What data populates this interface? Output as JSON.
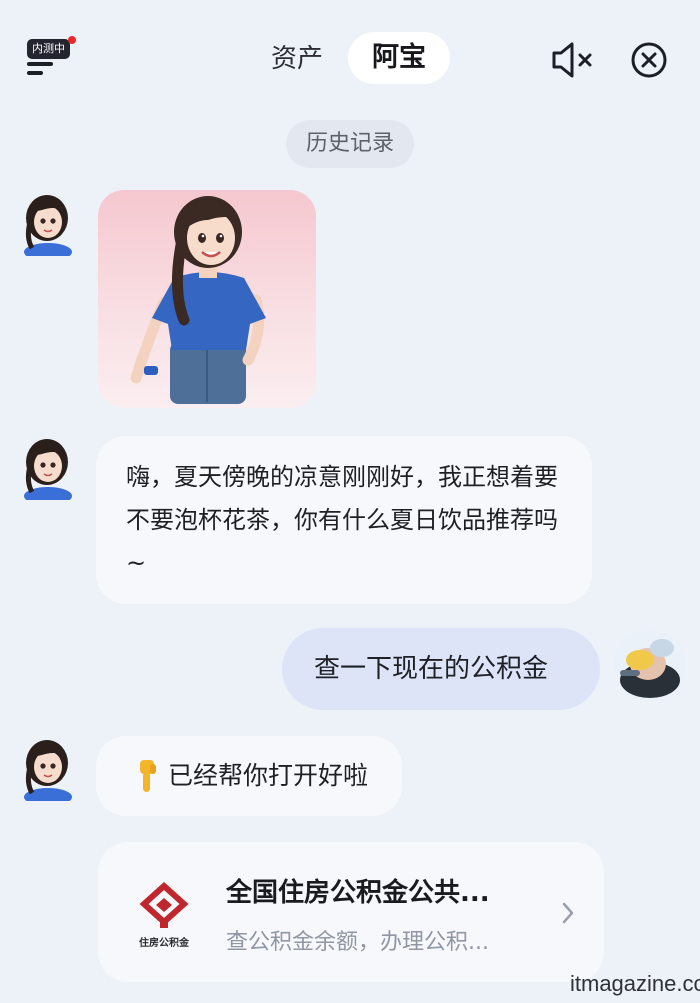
{
  "header": {
    "beta_badge": "内测中",
    "tabs": [
      {
        "label": "资产",
        "active": false
      },
      {
        "label": "阿宝",
        "active": true
      }
    ],
    "icons": {
      "menu": "menu-icon",
      "mute": "speaker-mute-icon",
      "close": "close-circle-icon"
    }
  },
  "history_label": "历史记录",
  "messages": [
    {
      "sender": "ai",
      "type": "image",
      "alt": "ai-character-portrait"
    },
    {
      "sender": "ai",
      "type": "text",
      "text": "嗨，夏天傍晚的凉意刚刚好，我正想着要不要泡杯花茶，你有什么夏日饮品推荐吗~"
    },
    {
      "sender": "user",
      "type": "text",
      "text": "查一下现在的公积金"
    },
    {
      "sender": "ai",
      "type": "text",
      "emoji": "👇",
      "text": "已经帮你打开好啦"
    }
  ],
  "service_card": {
    "logo_text": "住房公积金",
    "title": "全国住房公积金公共...",
    "desc": "查公积金余额，办理公积...",
    "brand_color": "#c0272d"
  },
  "colors": {
    "background": "#edf2f9",
    "bubble_ai": "#f6f8fc",
    "bubble_user": "#dde4f7",
    "accent_dot": "#ec2a2a"
  },
  "watermark": "itmagazine.cc"
}
